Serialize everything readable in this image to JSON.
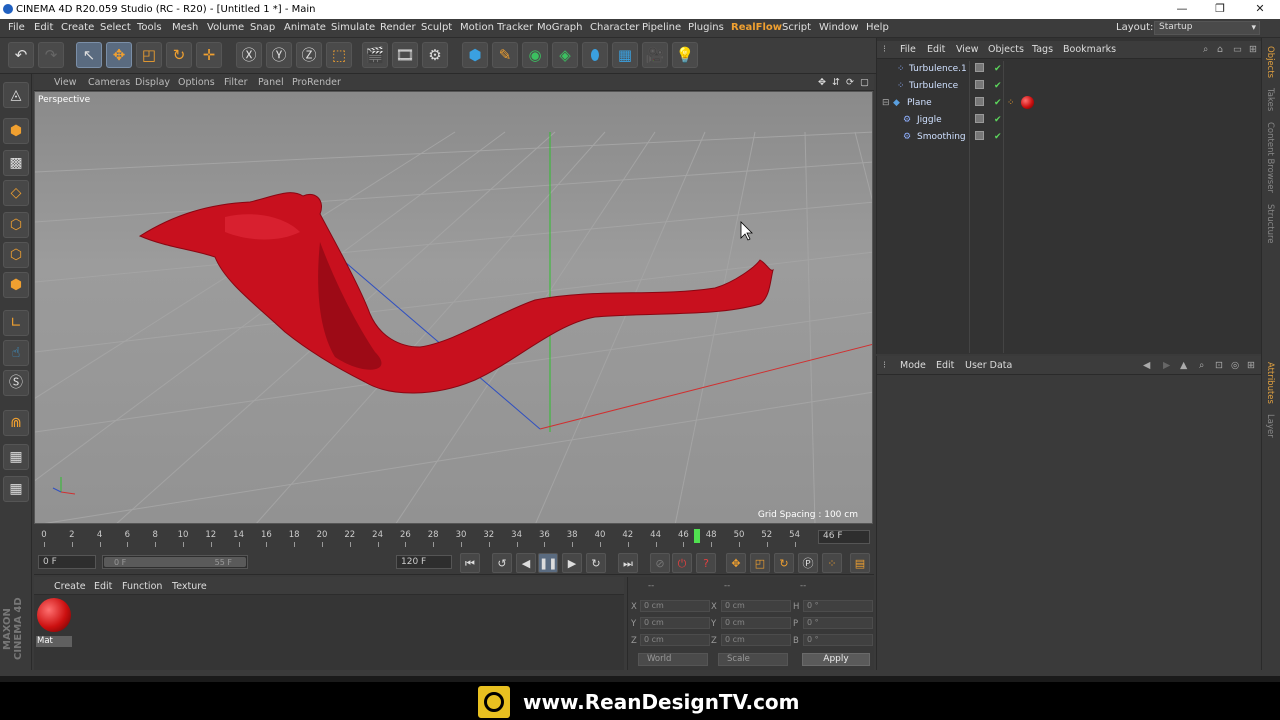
{
  "title_bar": {
    "title": "CINEMA 4D R20.059 Studio (RC - R20) - [Untitled 1 *] - Main",
    "minimize": "—",
    "restore": "❐",
    "close": "✕"
  },
  "menu": {
    "items": [
      "File",
      "Edit",
      "Create",
      "Select",
      "Tools",
      "Mesh",
      "Volume",
      "Snap",
      "Animate",
      "Simulate",
      "Render",
      "Sculpt",
      "Motion Tracker",
      "MoGraph",
      "Character",
      "Pipeline",
      "Plugins",
      "RealFlow",
      "Script",
      "Window",
      "Help"
    ],
    "layout_label": "Layout:",
    "layout_value": "Startup"
  },
  "viewport": {
    "menu": [
      "View",
      "Cameras",
      "Display",
      "Options",
      "Filter",
      "Panel",
      "ProRender"
    ],
    "label": "Perspective",
    "grid_spacing": "Grid Spacing : 100 cm",
    "object_color": "#c8101e"
  },
  "timeline": {
    "ticks": [
      "0",
      "2",
      "4",
      "6",
      "8",
      "10",
      "12",
      "14",
      "16",
      "18",
      "20",
      "22",
      "24",
      "26",
      "28",
      "30",
      "32",
      "34",
      "36",
      "38",
      "40",
      "42",
      "44",
      "46",
      "48",
      "50",
      "52",
      "54"
    ],
    "playhead_frame": 47,
    "current_frame": "46 F",
    "start_field": "0 F",
    "range_start": "0 F",
    "range_end": "55 F",
    "end_field": "120 F"
  },
  "material_manager": {
    "menu": [
      "Create",
      "Edit",
      "Function",
      "Texture"
    ],
    "materials": [
      {
        "name": "Mat",
        "color": "#cc1010"
      }
    ]
  },
  "coordinates": {
    "header_left": "--",
    "header_mid": "--",
    "header_right": "--",
    "rows": [
      {
        "l1": "X",
        "v1": "0 cm",
        "l2": "X",
        "v2": "0 cm",
        "l3": "H",
        "v3": "0 °"
      },
      {
        "l1": "Y",
        "v1": "0 cm",
        "l2": "Y",
        "v2": "0 cm",
        "l3": "P",
        "v3": "0 °"
      },
      {
        "l1": "Z",
        "v1": "0 cm",
        "l2": "Z",
        "v2": "0 cm",
        "l3": "B",
        "v3": "0 °"
      }
    ],
    "space": "World",
    "mode": "Scale",
    "apply": "Apply"
  },
  "object_manager": {
    "menu": [
      "File",
      "Edit",
      "View",
      "Objects",
      "Tags",
      "Bookmarks"
    ],
    "objects": [
      {
        "name": "Turbulence.1",
        "icon": "⁘"
      },
      {
        "name": "Turbulence",
        "icon": "⁘"
      },
      {
        "name": "Plane",
        "icon": "◆"
      },
      {
        "name": "Jiggle",
        "icon": "⚙"
      },
      {
        "name": "Smoothing",
        "icon": "⚙"
      }
    ]
  },
  "attribute_manager": {
    "menu": [
      "Mode",
      "Edit",
      "User Data"
    ]
  },
  "right_tabs": [
    "Objects",
    "Takes",
    "Content Browser",
    "Structure"
  ],
  "right_tabs_lower": [
    "Attributes",
    "Layer"
  ],
  "maxon_label": "MAXON CINEMA 4D",
  "brand": {
    "text": "www.ReanDesignTV.com"
  }
}
